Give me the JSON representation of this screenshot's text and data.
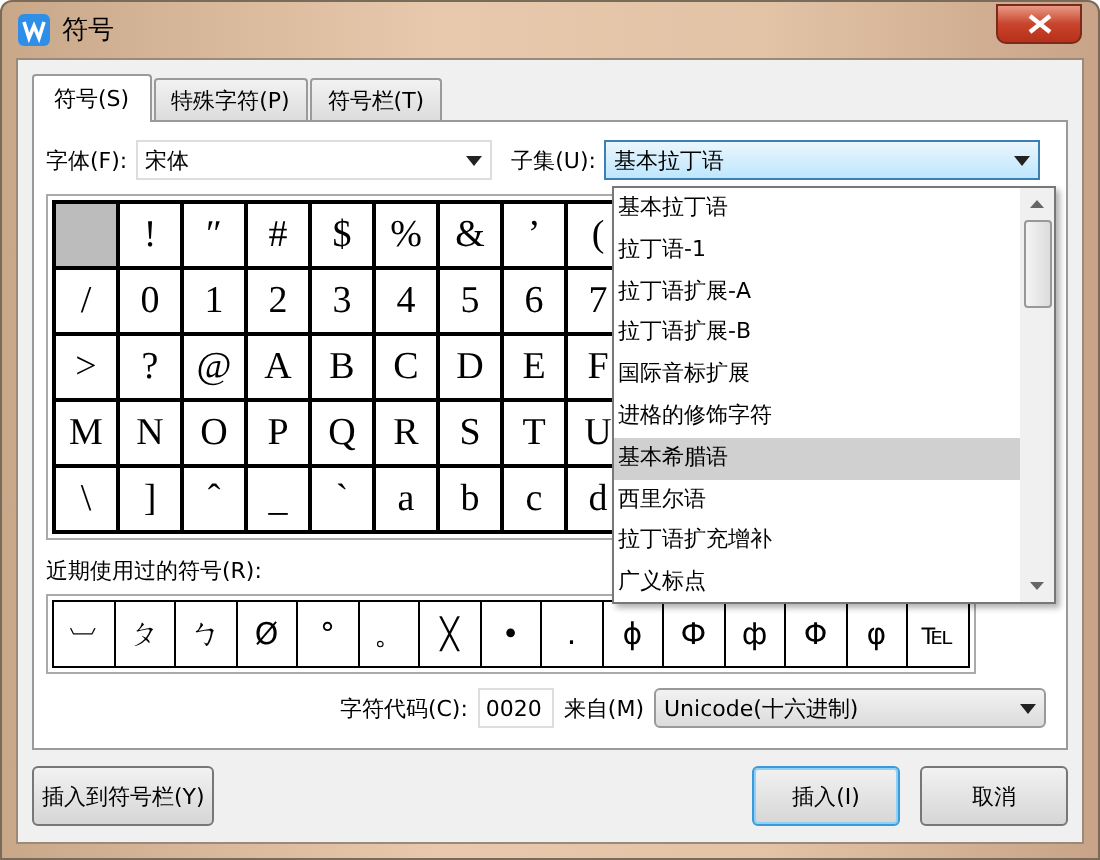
{
  "window": {
    "title": "符号"
  },
  "tabs": [
    {
      "label": "符号(S)",
      "selected": true
    },
    {
      "label": "特殊字符(P)",
      "selected": false
    },
    {
      "label": "符号栏(T)",
      "selected": false
    }
  ],
  "font": {
    "label": "字体(F):",
    "value": "宋体"
  },
  "subset": {
    "label": "子集(U):",
    "value": "基本拉丁语",
    "focused": true,
    "options": [
      {
        "label": "基本拉丁语",
        "highlighted": false
      },
      {
        "label": "拉丁语-1",
        "highlighted": false
      },
      {
        "label": "拉丁语扩展-A",
        "highlighted": false
      },
      {
        "label": "拉丁语扩展-B",
        "highlighted": false
      },
      {
        "label": "国际音标扩展",
        "highlighted": false
      },
      {
        "label": "进格的修饰字符",
        "highlighted": false
      },
      {
        "label": "基本希腊语",
        "highlighted": true
      },
      {
        "label": "西里尔语",
        "highlighted": false
      },
      {
        "label": "拉丁语扩充增补",
        "highlighted": false
      },
      {
        "label": "广义标点",
        "highlighted": false
      }
    ]
  },
  "symbol_grid": {
    "rows": [
      {
        "cells": [
          {
            "selected": true
          },
          {
            "char": "!",
            "selected": false
          },
          {
            "char": "″",
            "selected": false
          },
          {
            "char": "#",
            "selected": false
          },
          {
            "char": "$",
            "selected": false
          },
          {
            "char": "%",
            "selected": false
          },
          {
            "char": "&",
            "selected": false
          },
          {
            "char": "’",
            "selected": false
          },
          {
            "char": "(",
            "selected": false
          }
        ]
      },
      {
        "cells": [
          {
            "char": "/",
            "selected": false
          },
          {
            "char": "0",
            "selected": false
          },
          {
            "char": "1",
            "selected": false
          },
          {
            "char": "2",
            "selected": false
          },
          {
            "char": "3",
            "selected": false
          },
          {
            "char": "4",
            "selected": false
          },
          {
            "char": "5",
            "selected": false
          },
          {
            "char": "6",
            "selected": false
          },
          {
            "char": "7",
            "selected": false
          }
        ]
      },
      {
        "cells": [
          {
            "char": ">",
            "selected": false
          },
          {
            "char": "?",
            "selected": false
          },
          {
            "char": "@",
            "selected": false
          },
          {
            "char": "A",
            "selected": false
          },
          {
            "char": "B",
            "selected": false
          },
          {
            "char": "C",
            "selected": false
          },
          {
            "char": "D",
            "selected": false
          },
          {
            "char": "E",
            "selected": false
          },
          {
            "char": "F",
            "selected": false
          }
        ]
      },
      {
        "cells": [
          {
            "char": "M",
            "selected": false
          },
          {
            "char": "N",
            "selected": false
          },
          {
            "char": "O",
            "selected": false
          },
          {
            "char": "P",
            "selected": false
          },
          {
            "char": "Q",
            "selected": false
          },
          {
            "char": "R",
            "selected": false
          },
          {
            "char": "S",
            "selected": false
          },
          {
            "char": "T",
            "selected": false
          },
          {
            "char": "U",
            "selected": false
          }
        ]
      },
      {
        "cells": [
          {
            "char": "\\",
            "selected": false
          },
          {
            "char": "]",
            "selected": false
          },
          {
            "char": "ˆ",
            "selected": false
          },
          {
            "char": "_",
            "selected": false
          },
          {
            "char": "ˋ",
            "selected": false
          },
          {
            "char": "a",
            "selected": false
          },
          {
            "char": "b",
            "selected": false
          },
          {
            "char": "c",
            "selected": false
          },
          {
            "char": "d",
            "selected": false
          }
        ]
      }
    ]
  },
  "recent": {
    "label": "近期使用过的符号(R):",
    "symbols": [
      "︺",
      "ㄆ",
      "ㄅ",
      "Ø",
      "°",
      "。",
      "╳",
      "•",
      ".",
      "ɸ",
      "Ф",
      "ф",
      "Φ",
      "φ",
      "℡"
    ]
  },
  "char_code": {
    "label": "字符代码(C):",
    "value": "0020"
  },
  "from": {
    "label": "来自(M)",
    "value": "Unicode(十六进制)"
  },
  "buttons": [
    {
      "label": "插入到符号栏(Y)",
      "default": false
    },
    {
      "label": "插入(I)",
      "default": true
    },
    {
      "label": "取消",
      "default": false
    }
  ]
}
